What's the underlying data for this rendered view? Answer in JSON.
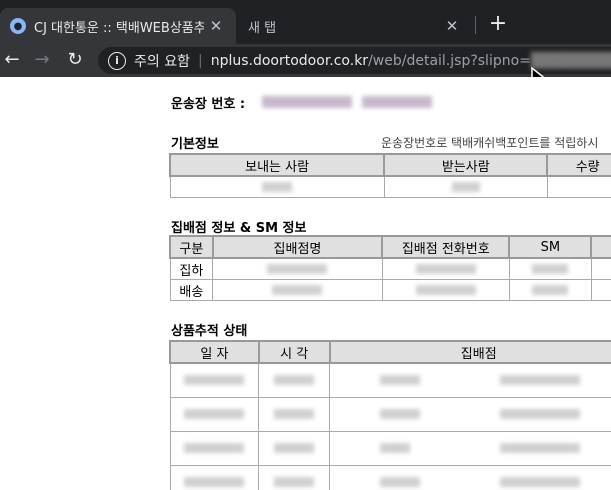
{
  "browser": {
    "active_tab_title": "CJ 대한통운 :: 택배WEB상품추적",
    "inactive_tab_title": "새 탭",
    "security_text": "주의 요함",
    "url_host": "nplus.doortodoor.co.kr",
    "url_path": "/web/detail.jsp?slipno="
  },
  "page": {
    "waybill_label": "운송장 번호 :",
    "basic_title": "기본정보",
    "basic_note": "운송장번호로 택배캐쉬백포인트를 적립하시",
    "basic_headers": [
      "보내는 사람",
      "받는사람",
      "수량"
    ],
    "branch_title": "집배점 정보 & SM 정보",
    "branch_headers": [
      "구분",
      "집배점명",
      "집배점 전화번호",
      "SM"
    ],
    "branch_rows": [
      "집하",
      "배송"
    ],
    "tracking_title": "상품추적 상태",
    "tracking_headers": [
      "일 자",
      "시 각",
      "집배점"
    ]
  }
}
